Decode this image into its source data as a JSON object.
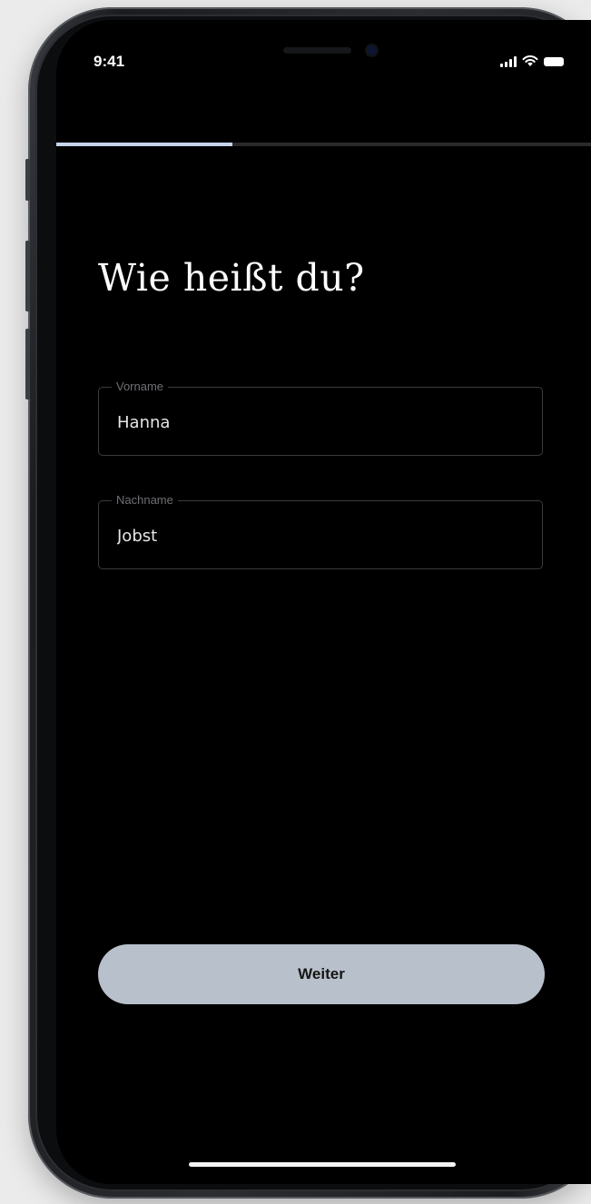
{
  "status_bar": {
    "time": "9:41",
    "icons": [
      "signal-icon",
      "wifi-icon",
      "battery-icon"
    ]
  },
  "progress": {
    "fraction": 0.33
  },
  "heading": "Wie heißt du?",
  "form": {
    "first_name": {
      "label": "Vorname",
      "value": "Hanna"
    },
    "last_name": {
      "label": "Nachname",
      "value": "Jobst"
    }
  },
  "button": {
    "label": "Weiter"
  },
  "colors": {
    "background": "#000000",
    "progress_fill": "#c7d4ec",
    "button_bg": "#b8c0cb",
    "field_border": "#3a3b3e",
    "label_text": "#6f7075"
  }
}
